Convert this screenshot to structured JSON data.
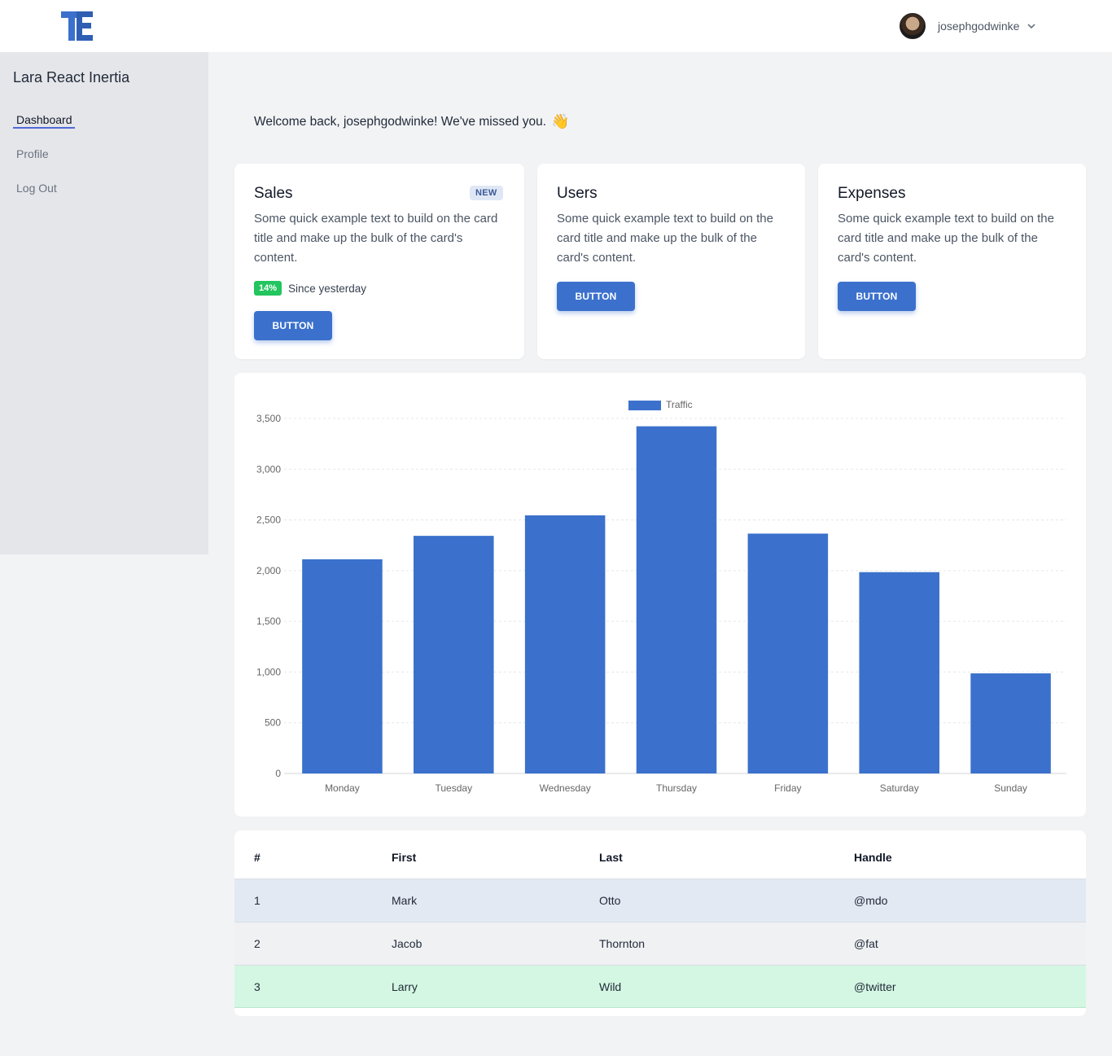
{
  "header": {
    "username": "josephgodwinke",
    "brand_color": "#3b71cc"
  },
  "sidebar": {
    "app_name": "Lara React Inertia",
    "items": [
      {
        "label": "Dashboard",
        "active": true
      },
      {
        "label": "Profile",
        "active": false
      },
      {
        "label": "Log Out",
        "active": false
      }
    ]
  },
  "main": {
    "welcome": "Welcome back, josephgodwinke! We've missed you.",
    "welcome_icon": "👋",
    "cards": [
      {
        "title": "Sales",
        "badge": "NEW",
        "text": "Some quick example text to build on the card title and make up the bulk of the card's content.",
        "stat_badge": "14%",
        "stat_text": "Since yesterday",
        "button": "BUTTON"
      },
      {
        "title": "Users",
        "text": "Some quick example text to build on the card title and make up the bulk of the card's content.",
        "button": "BUTTON"
      },
      {
        "title": "Expenses",
        "text": "Some quick example text to build on the card title and make up the bulk of the card's content.",
        "button": "BUTTON"
      }
    ],
    "table": {
      "headers": [
        "#",
        "First",
        "Last",
        "Handle"
      ],
      "rows": [
        {
          "num": "1",
          "first": "Mark",
          "last": "Otto",
          "handle": "@mdo",
          "bg": "#e3e9f3"
        },
        {
          "num": "2",
          "first": "Jacob",
          "last": "Thornton",
          "handle": "@fat",
          "bg": "#f0f1f3"
        },
        {
          "num": "3",
          "first": "Larry",
          "last": "Wild",
          "handle": "@twitter",
          "bg": "#d4f7e3"
        }
      ]
    }
  },
  "chart_data": {
    "type": "bar",
    "categories": [
      "Monday",
      "Tuesday",
      "Wednesday",
      "Thursday",
      "Friday",
      "Saturday",
      "Sunday"
    ],
    "series": [
      {
        "name": "Traffic",
        "values": [
          2112,
          2343,
          2545,
          3423,
          2365,
          1985,
          987
        ],
        "color": "#3b71cc"
      }
    ],
    "ylim": [
      0,
      3500
    ],
    "yticks": [
      0,
      500,
      1000,
      1500,
      2000,
      2500,
      3000,
      3500
    ],
    "ytick_labels": [
      "0",
      "500",
      "1,000",
      "1,500",
      "2,000",
      "2,500",
      "3,000",
      "3,500"
    ],
    "legend": "top-center",
    "grid": true
  }
}
